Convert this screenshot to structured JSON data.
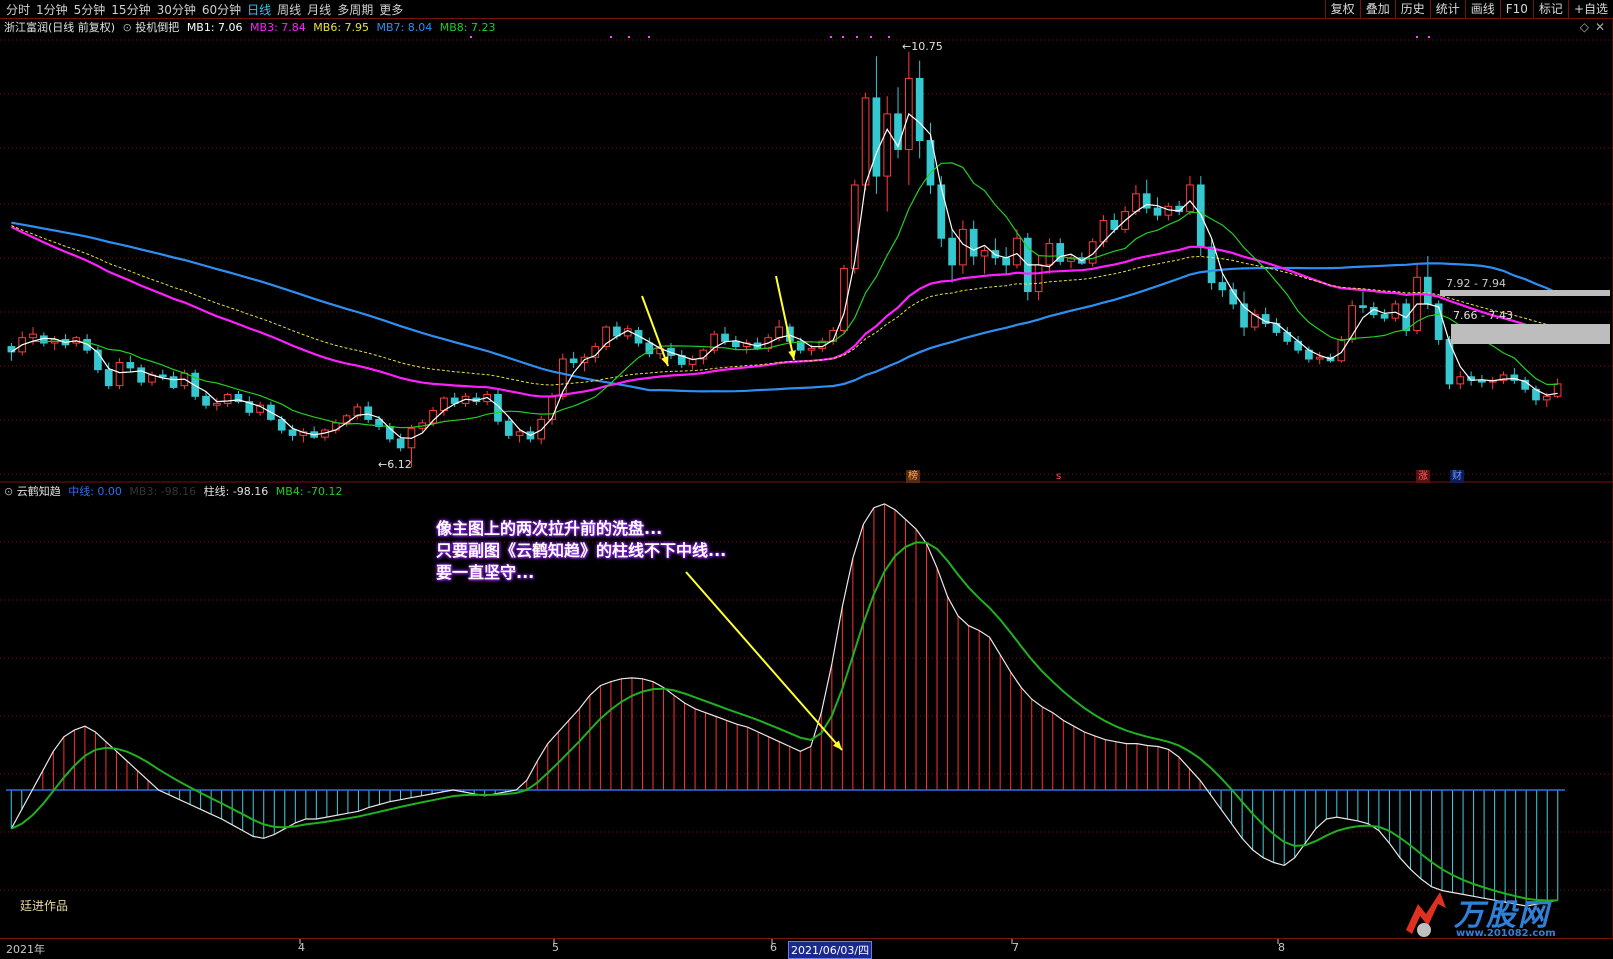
{
  "toolbar": {
    "periods": [
      "分时",
      "1分钟",
      "5分钟",
      "15分钟",
      "30分钟",
      "60分钟",
      "日线",
      "周线",
      "月线",
      "多周期",
      "更多"
    ],
    "active_period": "日线",
    "tools": [
      "复权",
      "叠加",
      "历史",
      "统计",
      "画线",
      "F10",
      "标记",
      "+自选"
    ]
  },
  "main_header": {
    "stock": "浙江富润(日线 前复权)",
    "indicator": "投机倒把",
    "mb1": "MB1: 7.06",
    "mb3": "MB3: 7.84",
    "mb6": "MB6: 7.95",
    "mb7": "MB7: 8.04",
    "mb8": "MB8: 7.23"
  },
  "sub_header": {
    "indicator": "云鹤知趋",
    "mid": "中线: 0.00",
    "mb3": "MB3: -98.16",
    "bar": "柱线: -98.16",
    "mb4": "MB4: -70.12"
  },
  "labels": {
    "high": "10.75",
    "low": "6.12",
    "price_box1": "7.92 - 7.94",
    "price_box2": "7.66 - 7.43",
    "tag_bang": "榜",
    "tag_s": "s",
    "tag_zhang": "涨",
    "tag_cai": "财",
    "author": "廷进作品",
    "logo_cn": "万股网",
    "logo_url": "www.201082.com"
  },
  "annotation": [
    "像主图上的两次拉升前的洗盘...",
    "只要副图《云鹤知趋》的柱线不下中线...",
    "要一直坚守..."
  ],
  "xaxis": {
    "labels": [
      "2021年",
      "4",
      "5",
      "6",
      "2021/06/03/四",
      "7",
      "8"
    ],
    "current": "2021/06/03/四"
  },
  "colors": {
    "up": "#ff3b3b",
    "down": "#36c8d0",
    "ma_white": "#ffffff",
    "ma_green": "#22cc22",
    "ma_magenta": "#ff20ff",
    "ma_blue": "#2f8ff0",
    "ma_yellow": "#e8e040",
    "osc_up": "#ff3030",
    "osc_down": "#40d0e0",
    "osc_signal": "#20b020",
    "grid": "#7a1010"
  },
  "chart_data": {
    "type": "candlestick",
    "price_range": [
      6.0,
      11.0
    ],
    "high_mark": 10.75,
    "low_mark": 6.12,
    "ohlc": [
      [
        7.48,
        7.52,
        7.32,
        7.42
      ],
      [
        7.42,
        7.65,
        7.38,
        7.58
      ],
      [
        7.58,
        7.7,
        7.5,
        7.62
      ],
      [
        7.6,
        7.64,
        7.48,
        7.52
      ],
      [
        7.52,
        7.6,
        7.44,
        7.56
      ],
      [
        7.56,
        7.62,
        7.46,
        7.5
      ],
      [
        7.52,
        7.6,
        7.48,
        7.58
      ],
      [
        7.56,
        7.62,
        7.4,
        7.44
      ],
      [
        7.44,
        7.48,
        7.18,
        7.22
      ],
      [
        7.22,
        7.3,
        7.0,
        7.04
      ],
      [
        7.04,
        7.35,
        7.0,
        7.3
      ],
      [
        7.3,
        7.38,
        7.2,
        7.24
      ],
      [
        7.24,
        7.28,
        7.04,
        7.08
      ],
      [
        7.08,
        7.2,
        7.04,
        7.16
      ],
      [
        7.16,
        7.22,
        7.1,
        7.14
      ],
      [
        7.14,
        7.2,
        7.0,
        7.02
      ],
      [
        7.04,
        7.22,
        7.0,
        7.18
      ],
      [
        7.18,
        7.22,
        6.88,
        6.92
      ],
      [
        6.92,
        6.98,
        6.78,
        6.82
      ],
      [
        6.82,
        6.9,
        6.76,
        6.84
      ],
      [
        6.84,
        6.96,
        6.8,
        6.94
      ],
      [
        6.94,
        6.98,
        6.84,
        6.86
      ],
      [
        6.86,
        6.92,
        6.7,
        6.74
      ],
      [
        6.74,
        6.86,
        6.7,
        6.82
      ],
      [
        6.82,
        6.86,
        6.64,
        6.66
      ],
      [
        6.66,
        6.7,
        6.5,
        6.54
      ],
      [
        6.54,
        6.6,
        6.42,
        6.48
      ],
      [
        6.48,
        6.56,
        6.4,
        6.52
      ],
      [
        6.52,
        6.58,
        6.44,
        6.46
      ],
      [
        6.46,
        6.56,
        6.42,
        6.54
      ],
      [
        6.54,
        6.66,
        6.5,
        6.62
      ],
      [
        6.62,
        6.72,
        6.58,
        6.7
      ],
      [
        6.7,
        6.84,
        6.66,
        6.8
      ],
      [
        6.8,
        6.86,
        6.62,
        6.66
      ],
      [
        6.66,
        6.7,
        6.54,
        6.58
      ],
      [
        6.58,
        6.62,
        6.4,
        6.44
      ],
      [
        6.44,
        6.5,
        6.3,
        6.34
      ],
      [
        6.34,
        6.6,
        6.12,
        6.56
      ],
      [
        6.56,
        6.66,
        6.52,
        6.62
      ],
      [
        6.62,
        6.8,
        6.58,
        6.76
      ],
      [
        6.76,
        6.92,
        6.7,
        6.9
      ],
      [
        6.9,
        6.96,
        6.8,
        6.84
      ],
      [
        6.84,
        6.96,
        6.8,
        6.92
      ],
      [
        6.9,
        6.96,
        6.82,
        6.86
      ],
      [
        6.86,
        6.98,
        6.82,
        6.94
      ],
      [
        6.94,
        7.0,
        6.6,
        6.64
      ],
      [
        6.64,
        6.7,
        6.44,
        6.48
      ],
      [
        6.48,
        6.56,
        6.4,
        6.52
      ],
      [
        6.52,
        6.58,
        6.4,
        6.44
      ],
      [
        6.44,
        6.7,
        6.38,
        6.66
      ],
      [
        6.66,
        6.96,
        6.6,
        6.92
      ],
      [
        6.92,
        7.4,
        6.88,
        7.34
      ],
      [
        7.34,
        7.42,
        7.24,
        7.3
      ],
      [
        7.3,
        7.4,
        7.2,
        7.36
      ],
      [
        7.36,
        7.52,
        7.3,
        7.48
      ],
      [
        7.48,
        7.72,
        7.44,
        7.7
      ],
      [
        7.7,
        7.76,
        7.56,
        7.6
      ],
      [
        7.6,
        7.72,
        7.56,
        7.68
      ],
      [
        7.66,
        7.7,
        7.48,
        7.52
      ],
      [
        7.52,
        7.58,
        7.36,
        7.4
      ],
      [
        7.4,
        7.5,
        7.34,
        7.46
      ],
      [
        7.46,
        7.52,
        7.34,
        7.38
      ],
      [
        7.38,
        7.44,
        7.24,
        7.28
      ],
      [
        7.28,
        7.38,
        7.22,
        7.34
      ],
      [
        7.34,
        7.46,
        7.28,
        7.44
      ],
      [
        7.44,
        7.66,
        7.4,
        7.62
      ],
      [
        7.62,
        7.7,
        7.5,
        7.54
      ],
      [
        7.54,
        7.6,
        7.44,
        7.48
      ],
      [
        7.48,
        7.56,
        7.4,
        7.52
      ],
      [
        7.52,
        7.58,
        7.44,
        7.46
      ],
      [
        7.46,
        7.62,
        7.42,
        7.58
      ],
      [
        7.58,
        7.78,
        7.54,
        7.7
      ],
      [
        7.7,
        7.74,
        7.5,
        7.54
      ],
      [
        7.54,
        7.58,
        7.4,
        7.44
      ],
      [
        7.44,
        7.5,
        7.38,
        7.46
      ],
      [
        7.46,
        7.58,
        7.42,
        7.54
      ],
      [
        7.54,
        7.7,
        7.5,
        7.66
      ],
      [
        7.66,
        8.4,
        7.62,
        8.36
      ],
      [
        8.36,
        9.36,
        8.3,
        9.3
      ],
      [
        9.3,
        10.34,
        9.24,
        10.28
      ],
      [
        10.28,
        10.75,
        9.2,
        9.4
      ],
      [
        9.4,
        10.3,
        9.0,
        10.1
      ],
      [
        10.1,
        10.4,
        9.6,
        9.7
      ],
      [
        9.7,
        10.8,
        9.3,
        10.5
      ],
      [
        10.5,
        10.7,
        9.6,
        9.8
      ],
      [
        9.8,
        10.0,
        9.2,
        9.3
      ],
      [
        9.3,
        9.4,
        8.6,
        8.7
      ],
      [
        8.7,
        8.8,
        8.2,
        8.4
      ],
      [
        8.4,
        8.9,
        8.3,
        8.8
      ],
      [
        8.8,
        8.9,
        8.4,
        8.5
      ],
      [
        8.5,
        8.6,
        8.3,
        8.56
      ],
      [
        8.56,
        8.7,
        8.4,
        8.48
      ],
      [
        8.48,
        8.6,
        8.3,
        8.4
      ],
      [
        8.4,
        8.8,
        8.36,
        8.7
      ],
      [
        8.7,
        8.76,
        8.0,
        8.1
      ],
      [
        8.1,
        8.5,
        8.0,
        8.4
      ],
      [
        8.4,
        8.7,
        8.3,
        8.64
      ],
      [
        8.64,
        8.7,
        8.4,
        8.44
      ],
      [
        8.44,
        8.52,
        8.36,
        8.48
      ],
      [
        8.48,
        8.54,
        8.4,
        8.42
      ],
      [
        8.42,
        8.7,
        8.38,
        8.66
      ],
      [
        8.66,
        8.96,
        8.6,
        8.9
      ],
      [
        8.9,
        8.98,
        8.76,
        8.8
      ],
      [
        8.8,
        9.06,
        8.76,
        9.0
      ],
      [
        9.0,
        9.3,
        8.96,
        9.2
      ],
      [
        9.2,
        9.36,
        8.98,
        9.04
      ],
      [
        9.04,
        9.16,
        8.9,
        8.96
      ],
      [
        8.96,
        9.1,
        8.9,
        9.06
      ],
      [
        9.06,
        9.12,
        8.96,
        9.0
      ],
      [
        9.0,
        9.4,
        8.96,
        9.3
      ],
      [
        9.3,
        9.4,
        8.5,
        8.6
      ],
      [
        8.6,
        8.7,
        8.12,
        8.2
      ],
      [
        8.2,
        8.3,
        8.04,
        8.12
      ],
      [
        8.12,
        8.2,
        7.9,
        7.96
      ],
      [
        7.96,
        8.1,
        7.6,
        7.7
      ],
      [
        7.7,
        7.9,
        7.66,
        7.84
      ],
      [
        7.84,
        7.92,
        7.7,
        7.74
      ],
      [
        7.74,
        7.8,
        7.6,
        7.64
      ],
      [
        7.64,
        7.7,
        7.5,
        7.54
      ],
      [
        7.54,
        7.6,
        7.4,
        7.44
      ],
      [
        7.44,
        7.48,
        7.3,
        7.34
      ],
      [
        7.34,
        7.42,
        7.28,
        7.36
      ],
      [
        7.36,
        7.4,
        7.3,
        7.32
      ],
      [
        7.32,
        7.6,
        7.3,
        7.56
      ],
      [
        7.56,
        8.0,
        7.52,
        7.94
      ],
      [
        7.94,
        8.1,
        7.86,
        7.92
      ],
      [
        7.92,
        7.98,
        7.8,
        7.84
      ],
      [
        7.84,
        7.9,
        7.76,
        7.8
      ],
      [
        7.8,
        8.0,
        7.76,
        7.96
      ],
      [
        7.96,
        8.02,
        7.6,
        7.66
      ],
      [
        7.66,
        8.4,
        7.62,
        8.26
      ],
      [
        8.26,
        8.5,
        7.9,
        7.96
      ],
      [
        7.96,
        8.0,
        7.5,
        7.56
      ],
      [
        7.56,
        7.6,
        7.0,
        7.06
      ],
      [
        7.06,
        7.2,
        7.0,
        7.14
      ],
      [
        7.14,
        7.2,
        7.04,
        7.1
      ],
      [
        7.1,
        7.16,
        7.02,
        7.08
      ],
      [
        7.08,
        7.14,
        7.0,
        7.1
      ],
      [
        7.1,
        7.2,
        7.06,
        7.16
      ],
      [
        7.16,
        7.24,
        7.06,
        7.1
      ],
      [
        7.1,
        7.14,
        6.96,
        7.0
      ],
      [
        7.0,
        7.04,
        6.82,
        6.88
      ],
      [
        6.88,
        6.96,
        6.8,
        6.92
      ],
      [
        6.92,
        7.12,
        6.9,
        7.06
      ]
    ],
    "oscillator": {
      "zero_line": 0,
      "range": [
        -120,
        300
      ],
      "line": [
        -40,
        -20,
        0,
        20,
        40,
        55,
        62,
        66,
        60,
        50,
        40,
        30,
        20,
        10,
        0,
        -5,
        -10,
        -15,
        -20,
        -25,
        -30,
        -36,
        -42,
        -48,
        -50,
        -46,
        -40,
        -34,
        -30,
        -30,
        -28,
        -26,
        -24,
        -22,
        -18,
        -15,
        -12,
        -10,
        -8,
        -6,
        -4,
        -2,
        0,
        -2,
        -4,
        -6,
        -4,
        -2,
        0,
        10,
        30,
        48,
        60,
        72,
        84,
        98,
        108,
        112,
        115,
        116,
        115,
        112,
        106,
        98,
        90,
        84,
        80,
        76,
        72,
        68,
        65,
        60,
        55,
        50,
        45,
        40,
        45,
        80,
        130,
        190,
        240,
        275,
        292,
        296,
        290,
        280,
        270,
        255,
        230,
        200,
        180,
        170,
        165,
        158,
        140,
        122,
        106,
        94,
        86,
        80,
        72,
        66,
        60,
        56,
        52,
        50,
        48,
        48,
        46,
        45,
        42,
        34,
        22,
        10,
        -5,
        -20,
        -35,
        -50,
        -62,
        -70,
        -75,
        -78,
        -70,
        -55,
        -40,
        -30,
        -28,
        -30,
        -32,
        -35,
        -42,
        -55,
        -70,
        -82,
        -92,
        -100,
        -104,
        -106,
        -108,
        -110,
        -112,
        -114,
        -116,
        -118,
        -120,
        -118,
        -116,
        -114
      ]
    }
  }
}
